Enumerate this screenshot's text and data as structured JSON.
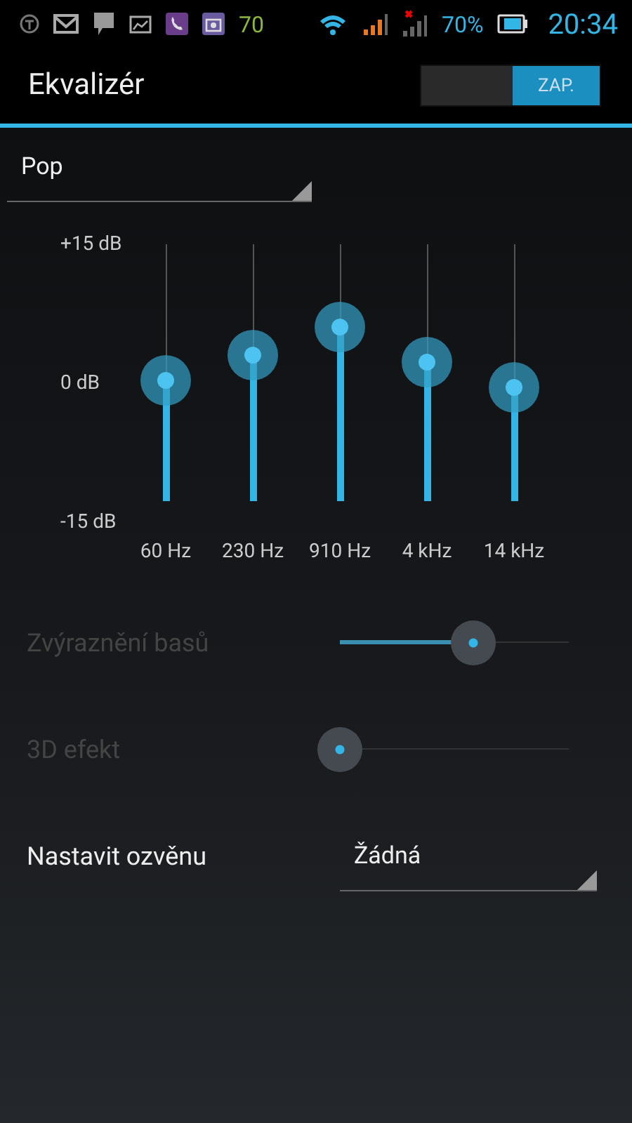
{
  "status_bar": {
    "icons": [
      {
        "kind": "circle"
      },
      {
        "kind": "mail"
      },
      {
        "kind": "chat"
      },
      {
        "kind": "image"
      },
      {
        "kind": "phone"
      },
      {
        "kind": "camera"
      }
    ],
    "counter": "70",
    "battery_text": "70%",
    "time": "20:34"
  },
  "header": {
    "title": "Ekvalizér",
    "switch": {
      "label": "ZAP.",
      "on": true
    }
  },
  "preset": {
    "value": "Pop"
  },
  "equalizer": {
    "scale": [
      "+15 dB",
      "0 dB",
      "-15 dB"
    ],
    "bands": [
      {
        "label": "60 Hz",
        "level": 0.47
      },
      {
        "label": "230 Hz",
        "level": 0.57
      },
      {
        "label": "910 Hz",
        "level": 0.68
      },
      {
        "label": "4 kHz",
        "level": 0.54
      },
      {
        "label": "14 kHz",
        "level": 0.44
      }
    ]
  },
  "effects": [
    {
      "label": "Zvýraznění basů",
      "disabled": true,
      "level": 0.58
    },
    {
      "label": "3D efekt",
      "disabled": true,
      "level": 0
    }
  ],
  "reverb": {
    "label": "Nastavit ozvěnu",
    "value": "Žádná"
  }
}
